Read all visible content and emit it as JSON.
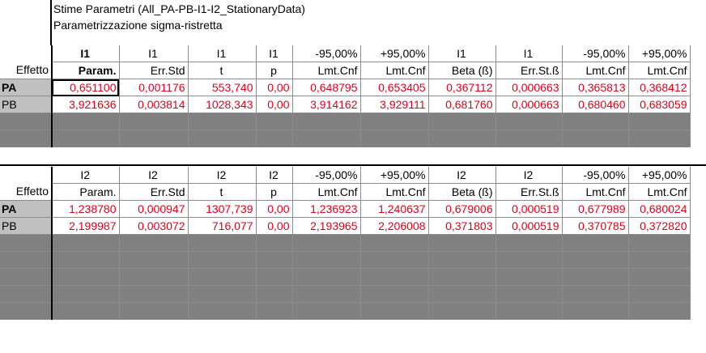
{
  "title": "Stime Parametri (All_PA-PB-I1-I2_StationaryData)",
  "subtitle": "Parametrizzazione sigma-ristretta",
  "block1": {
    "row_header_label": "Effetto",
    "header_top": [
      "I1",
      "I1",
      "I1",
      "I1",
      "-95,00%",
      "+95,00%",
      "I1",
      "I1",
      "-95,00%",
      "+95,00%"
    ],
    "header_bottom": [
      "Param.",
      "Err.Std",
      "t",
      "p",
      "Lmt.Cnf",
      "Lmt.Cnf",
      "Beta (ß)",
      "Err.St.ß",
      "Lmt.Cnf",
      "Lmt.Cnf"
    ],
    "rows": [
      {
        "label": "PA",
        "cells": [
          "0,651100",
          "0,001176",
          "553,740",
          "0,00",
          "0,648795",
          "0,653405",
          "0,367112",
          "0,000663",
          "0,365813",
          "0,368412"
        ]
      },
      {
        "label": "PB",
        "cells": [
          "3,921636",
          "0,003814",
          "1028,343",
          "0,00",
          "3,914162",
          "3,929111",
          "0,681760",
          "0,000663",
          "0,680460",
          "0,683059"
        ]
      }
    ]
  },
  "block2": {
    "row_header_label": "Effetto",
    "header_top": [
      "I2",
      "I2",
      "I2",
      "I2",
      "-95,00%",
      "+95,00%",
      "I2",
      "I2",
      "-95,00%",
      "+95,00%"
    ],
    "header_bottom": [
      "Param.",
      "Err.Std",
      "t",
      "p",
      "Lmt.Cnf",
      "Lmt.Cnf",
      "Beta (ß)",
      "Err.St.ß",
      "Lmt.Cnf",
      "Lmt.Cnf"
    ],
    "rows": [
      {
        "label": "PA",
        "cells": [
          "1,238780",
          "0,000947",
          "1307,739",
          "0,00",
          "1,236923",
          "1,240637",
          "0,679006",
          "0,000519",
          "0,677989",
          "0,680024"
        ]
      },
      {
        "label": "PB",
        "cells": [
          "2,199987",
          "0,003072",
          "716,077",
          "0,00",
          "2,193965",
          "2,206008",
          "0,371803",
          "0,000519",
          "0,370785",
          "0,372820"
        ]
      }
    ]
  },
  "colors": {
    "value_red": "#e0001b",
    "label_gray": "#c0c0c0",
    "empty_gray": "#808080"
  }
}
